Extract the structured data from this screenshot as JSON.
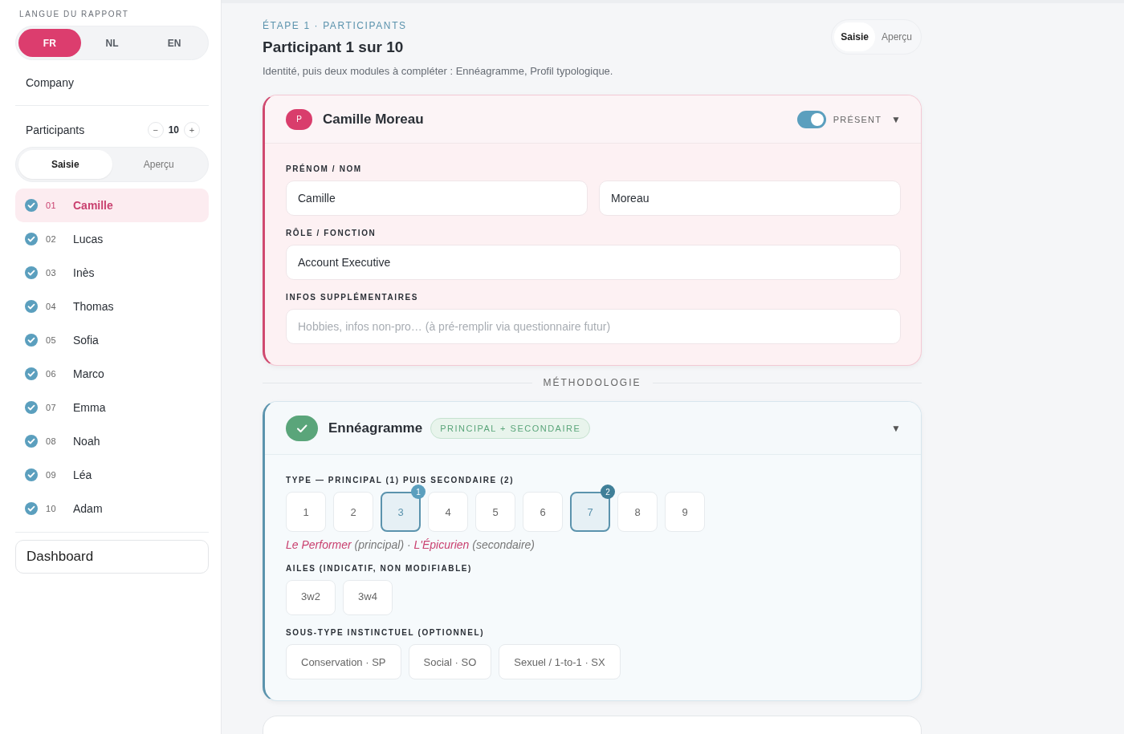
{
  "sidebar": {
    "language_label": "LANGUE DU RAPPORT",
    "languages": [
      {
        "label": "FR",
        "selected": true
      },
      {
        "label": "NL",
        "selected": false
      },
      {
        "label": "EN",
        "selected": false
      }
    ],
    "company": "Company",
    "participants_label": "Participants",
    "count": "10",
    "minus": "−",
    "plus": "+",
    "view_tabs": [
      {
        "label": "Saisie",
        "selected": true
      },
      {
        "label": "Aperçu",
        "selected": false
      }
    ],
    "participants": [
      {
        "number": "01",
        "name": "Camille",
        "checked": true,
        "selected": true
      },
      {
        "number": "02",
        "name": "Lucas",
        "checked": true,
        "selected": false
      },
      {
        "number": "03",
        "name": "Inès",
        "checked": true,
        "selected": false
      },
      {
        "number": "04",
        "name": "Thomas",
        "checked": true,
        "selected": false
      },
      {
        "number": "05",
        "name": "Sofia",
        "checked": true,
        "selected": false
      },
      {
        "number": "06",
        "name": "Marco",
        "checked": true,
        "selected": false
      },
      {
        "number": "07",
        "name": "Emma",
        "checked": true,
        "selected": false
      },
      {
        "number": "08",
        "name": "Noah",
        "checked": true,
        "selected": false
      },
      {
        "number": "09",
        "name": "Léa",
        "checked": true,
        "selected": false
      },
      {
        "number": "10",
        "name": "Adam",
        "checked": true,
        "selected": false
      }
    ],
    "dashboard": "Dashboard"
  },
  "header": {
    "step": "ÉTAPE 1 · PARTICIPANTS",
    "title": "Participant 1 sur 10",
    "subtitle": "Identité, puis deux modules à compléter : Ennéagramme, Profil typologique.",
    "view_tabs": [
      {
        "label": "Saisie",
        "selected": true
      },
      {
        "label": "Aperçu",
        "selected": false
      }
    ]
  },
  "participant_card": {
    "avatar": "P",
    "name": "Camille Moreau",
    "present": {
      "on": true,
      "label": "PRÉSENT"
    },
    "caret": "▼",
    "fields": [
      {
        "label": "PRÉNOM / NOM",
        "inputs": [
          {
            "value": "Camille"
          },
          {
            "value": "Moreau"
          }
        ]
      },
      {
        "label": "RÔLE / FONCTION",
        "inputs": [
          {
            "value": "Account Executive"
          }
        ]
      },
      {
        "label": "INFOS SUPPLÉMENTAIRES",
        "inputs": [
          {
            "placeholder": "Hobbies, infos non-pro… (à pré-remplir via questionnaire futur)"
          }
        ]
      }
    ]
  },
  "divider_label": "MÉTHODOLOGIE",
  "enneagram_card": {
    "title": "Ennéagramme",
    "done": true,
    "tag": "PRINCIPAL + SECONDAIRE",
    "caret": "▼",
    "type_label": "TYPE — PRINCIPAL (1) PUIS SECONDAIRE (2)",
    "types": [
      {
        "label": "1",
        "selected": false
      },
      {
        "label": "2",
        "selected": false
      },
      {
        "label": "3",
        "selected": true,
        "badge": "1"
      },
      {
        "label": "4",
        "selected": false
      },
      {
        "label": "5",
        "selected": false
      },
      {
        "label": "6",
        "selected": false
      },
      {
        "label": "7",
        "selected": true,
        "badge": "2"
      },
      {
        "label": "8",
        "selected": false
      },
      {
        "label": "9",
        "selected": false
      }
    ],
    "summary": [
      {
        "text": "Le Performer",
        "kind": "name"
      },
      {
        "text": " (principal) · ",
        "kind": "note"
      },
      {
        "text": "L'Épicurien",
        "kind": "name"
      },
      {
        "text": " (secondaire)",
        "kind": "note"
      }
    ],
    "wings_label": "AILES (INDICATIF, NON MODIFIABLE)",
    "wings": [
      "3w2",
      "3w4"
    ],
    "subtype_label": "SOUS-TYPE INSTINCTUEL (OPTIONNEL)",
    "subtypes": [
      {
        "label": "Conservation · SP",
        "selected": false
      },
      {
        "label": "Social · SO",
        "selected": false
      },
      {
        "label": "Sexuel / 1-to-1 · SX",
        "selected": false
      }
    ]
  }
}
